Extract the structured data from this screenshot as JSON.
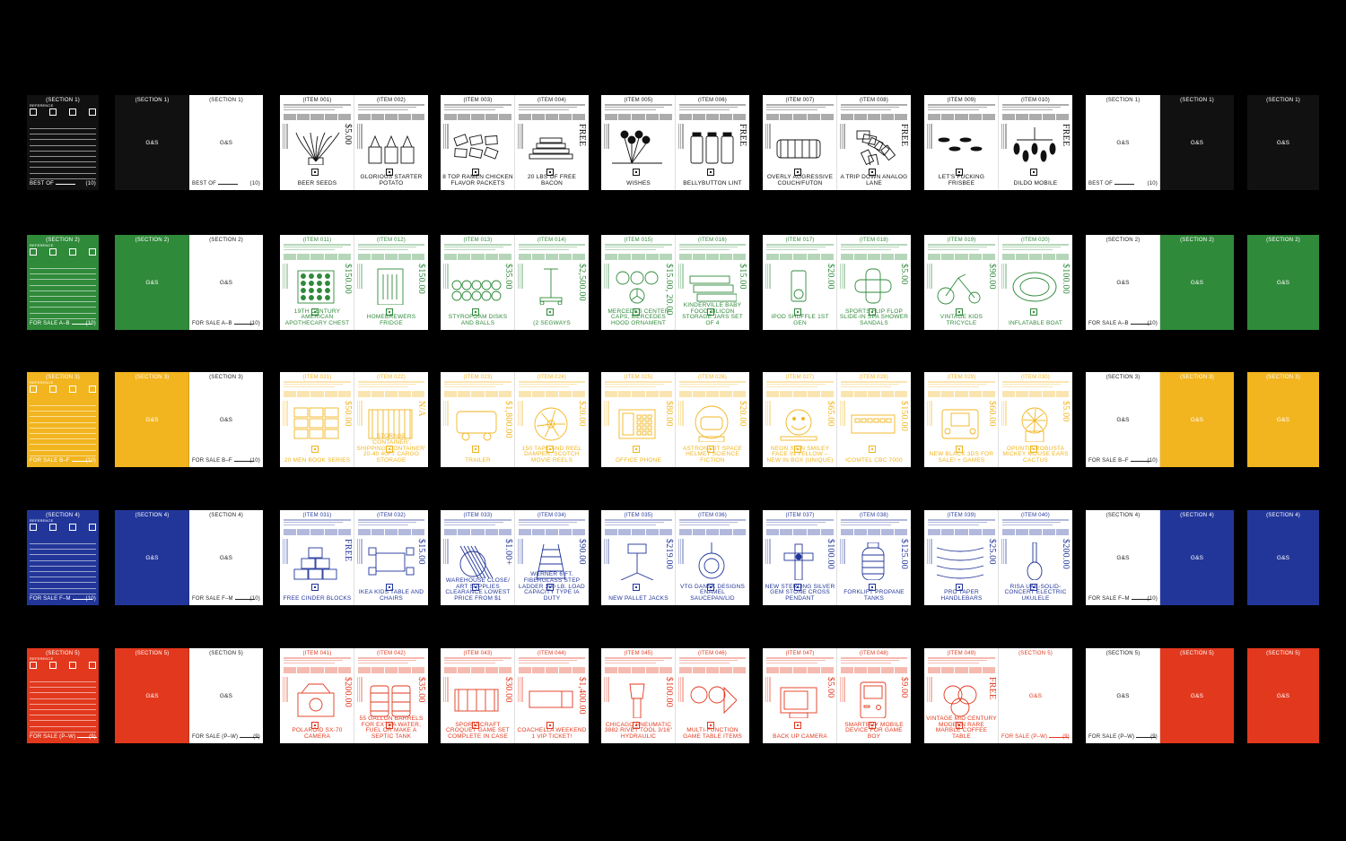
{
  "colors": {
    "black": "#111111",
    "green": "#2f8a3a",
    "yellow": "#f2b51f",
    "blue": "#22369a",
    "red": "#e2381d",
    "paper": "#ffffff"
  },
  "logo": "G&S",
  "reference_label": "REFERENCE",
  "rows": [
    {
      "color": "black",
      "section_label": "(SECTION 1)",
      "footer": "BEST OF",
      "count": "(10)",
      "items": [
        {
          "label": "(ITEM 001)",
          "name": "BEER SEEDS",
          "price": "$5.00",
          "shape": "plant"
        },
        {
          "label": "(ITEM 002)",
          "name": "GLORIOUS STARTER POTATO",
          "price": "",
          "shape": "pots"
        },
        {
          "label": "(ITEM 003)",
          "name": "8 TOP RAMEN CHICKEN FLAVOR PACKETS",
          "price": "",
          "shape": "packets"
        },
        {
          "label": "(ITEM 004)",
          "name": "20 LBS OF FREE BACON",
          "price": "FREE",
          "shape": "stack"
        },
        {
          "label": "(ITEM 005)",
          "name": "WISHES",
          "price": "",
          "shape": "balloons"
        },
        {
          "label": "(ITEM 006)",
          "name": "BELLYBUTTON LINT",
          "price": "FREE",
          "shape": "jars"
        },
        {
          "label": "(ITEM 007)",
          "name": "OVERLY AGGRESSIVE COUCH/FUTON",
          "price": "",
          "shape": "couch"
        },
        {
          "label": "(ITEM 008)",
          "name": "A TRIP DOWN ANALOG LANE",
          "price": "FREE",
          "shape": "pile"
        },
        {
          "label": "(ITEM 009)",
          "name": "LET'S FUCKING FRISBEE",
          "price": "",
          "shape": "discs"
        },
        {
          "label": "(ITEM 010)",
          "name": "DILDO MOBILE",
          "price": "FREE",
          "shape": "mobile"
        }
      ]
    },
    {
      "color": "green",
      "section_label": "(SECTION 2)",
      "footer": "FOR SALE A–B",
      "count": "(10)",
      "items": [
        {
          "label": "(ITEM 011)",
          "name": "19TH CENTURY AMERICAN APOTHECARY CHEST",
          "price": "$150.00",
          "shape": "chest"
        },
        {
          "label": "(ITEM 012)",
          "name": "HOMEBREWERS FRIDGE",
          "price": "$150.00",
          "shape": "fridge"
        },
        {
          "label": "(ITEM 013)",
          "name": "STYROFOAM DISKS AND BALLS",
          "price": "$35.00",
          "shape": "disks"
        },
        {
          "label": "(ITEM 014)",
          "name": "(2 SEGWAYS",
          "price": "$2,500.00",
          "shape": "segway"
        },
        {
          "label": "(ITEM 015)",
          "name": "MERCEDES CENTER CAPS, MERCEDES HOOD ORNAMENT",
          "price": "$15.00, 20.00",
          "shape": "rings"
        },
        {
          "label": "(ITEM 016)",
          "name": "KINDERVILLE BABY FOOD SILICON STORAGE JARS SET OF 4",
          "price": "$15.00",
          "shape": "trays"
        },
        {
          "label": "(ITEM 017)",
          "name": "IPOD SHUFFLE 1ST GEN",
          "price": "$20.00",
          "shape": "ipod"
        },
        {
          "label": "(ITEM 018)",
          "name": "SPORTS FLIP FLOP SLIDE-IN SPA SHOWER SANDALS",
          "price": "$5.00",
          "shape": "sandals"
        },
        {
          "label": "(ITEM 019)",
          "name": "VINTAGE KIDS TRICYCLE",
          "price": "$90.00",
          "shape": "tricycle"
        },
        {
          "label": "(ITEM 020)",
          "name": "INFLATABLE BOAT",
          "price": "$100.00",
          "shape": "boat"
        }
      ]
    },
    {
      "color": "yellow",
      "section_label": "(SECTION 3)",
      "footer": "FOR SALE B–F",
      "count": "(10)",
      "items": [
        {
          "label": "(ITEM 021)",
          "name": "20 MEN BOOK SERIES",
          "price": "$50.00",
          "shape": "grid"
        },
        {
          "label": "(ITEM 022)",
          "name": "STORAGE 'CONTAINER', SHIPPING 'CONTAINER' 20-40 40FT CARGO STORAGE",
          "price": "N/A",
          "shape": "container"
        },
        {
          "label": "(ITEM 023)",
          "name": "TRAILER",
          "price": "$1,800.00",
          "shape": "trailer"
        },
        {
          "label": "(ITEM 024)",
          "name": "150 TAPE AND REEL DAMPER, SCOTCH MOVIE REELS",
          "price": "$20.00",
          "shape": "reel"
        },
        {
          "label": "(ITEM 025)",
          "name": "OFFICE PHONE",
          "price": "$80.00",
          "shape": "phone"
        },
        {
          "label": "(ITEM 026)",
          "name": "ASTRONAUT SPACE HELMET SCIENCE FICTION",
          "price": "$20.00",
          "shape": "helmet"
        },
        {
          "label": "(ITEM 027)",
          "name": "NEON SIGN SMILEY FACE IN YELLOW – NEW IN BOX (UNIQUE)",
          "price": "$65.00",
          "shape": "smiley"
        },
        {
          "label": "(ITEM 028)",
          "name": "ICOMTEL CBC 7000",
          "price": "$150.00",
          "shape": "radio"
        },
        {
          "label": "(ITEM 029)",
          "name": "NEW BLACK 3DS FOR SALE! + GAMES",
          "price": "$60.00",
          "shape": "console"
        },
        {
          "label": "(ITEM 030)",
          "name": "OPUNTIA ROBUSTA MICKEY MOUSE EARS CACTUS",
          "price": "$5.00",
          "shape": "cactus"
        }
      ]
    },
    {
      "color": "blue",
      "section_label": "(SECTION 4)",
      "footer": "FOR SALE F–M",
      "count": "(10)",
      "items": [
        {
          "label": "(ITEM 031)",
          "name": "FREE CINDER BLOCKS",
          "price": "FREE",
          "shape": "blocks"
        },
        {
          "label": "(ITEM 032)",
          "name": "IKEA KIDS TABLE AND CHAIRS",
          "price": "$15.00",
          "shape": "table"
        },
        {
          "label": "(ITEM 033)",
          "name": "WAREHOUSE CLOSE/ ART SUPPLIES CLEARANCE LOWEST PRICE FROM $1",
          "price": "$1.00+",
          "shape": "supplies"
        },
        {
          "label": "(ITEM 034)",
          "name": "WERNER 6 FT. FIBERGLASS STEP LADDER 300 LB. LOAD CAPACITY TYPE IA DUTY",
          "price": "$90.00",
          "shape": "ladder"
        },
        {
          "label": "(ITEM 035)",
          "name": "NEW PALLET JACKS",
          "price": "$219.00",
          "shape": "jack"
        },
        {
          "label": "(ITEM 036)",
          "name": "VTG DANSK DESIGNS ENAMEL SAUCEPAN/LID",
          "price": "",
          "shape": "pan"
        },
        {
          "label": "(ITEM 037)",
          "name": "NEW STERLING SILVER GEM STONE CROSS PENDANT",
          "price": "$100.00",
          "shape": "cross"
        },
        {
          "label": "(ITEM 038)",
          "name": "FORKLIFT PROPANE TANKS",
          "price": "$125.00",
          "shape": "tank"
        },
        {
          "label": "(ITEM 039)",
          "name": "PRO TAPER HANDLEBARS",
          "price": "$25.00",
          "shape": "bars"
        },
        {
          "label": "(ITEM 040)",
          "name": "RISA UKE-SOLID-CONCERT ELECTRIC UKULELE",
          "price": "$200.00",
          "shape": "ukulele"
        }
      ]
    },
    {
      "color": "red",
      "section_label": "(SECTION 5)",
      "footer": "FOR SALE (P–W)",
      "count": "(9)",
      "items": [
        {
          "label": "(ITEM 041)",
          "name": "POLAROID SX-70 CAMERA",
          "price": "$200.00",
          "shape": "camera"
        },
        {
          "label": "(ITEM 042)",
          "name": "55 GALLON BARRELS FOR EXTRA WATER, FUEL OR MAKE A SEPTIC TANK",
          "price": "$35.00",
          "shape": "barrel"
        },
        {
          "label": "(ITEM 043)",
          "name": "SPORTSCRAFT CROQUET GAME SET COMPLETE IN CASE",
          "price": "$30.00",
          "shape": "croquet"
        },
        {
          "label": "(ITEM 044)",
          "name": "COACHELLA WEEKEND 1 VIP TICKET!",
          "price": "$1,400.00",
          "shape": "ticket"
        },
        {
          "label": "(ITEM 045)",
          "name": "CHICAGO PNEUMATIC 3882 RIVET TOOL 3/16\" HYDRAULIC",
          "price": "$100.00",
          "shape": "rivet"
        },
        {
          "label": "(ITEM 046)",
          "name": "MULTI-FUNCTION GAME TABLE ITEMS",
          "price": "",
          "shape": "paddles"
        },
        {
          "label": "(ITEM 047)",
          "name": "BACK UP CAMERA",
          "price": "$5.00",
          "shape": "tv"
        },
        {
          "label": "(ITEM 048)",
          "name": "SMARTBOY MOBILE DEVICE FOR GAME BOY",
          "price": "$9.00",
          "shape": "gameboy"
        },
        {
          "label": "(ITEM 049)",
          "name": "VINTAGE MID CENTURY MODERN RARE MARBLE COFFEE TABLE",
          "price": "FREE",
          "shape": "venn"
        }
      ]
    }
  ]
}
